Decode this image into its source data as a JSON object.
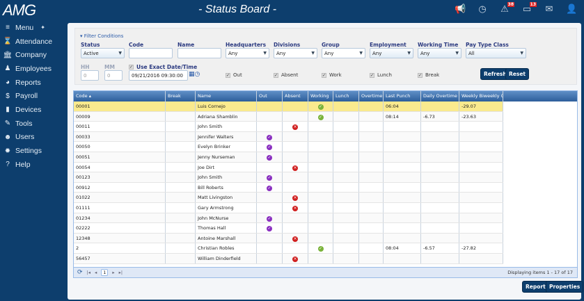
{
  "app": {
    "logo": "AMG",
    "title": "- Status Board -"
  },
  "topbar": {
    "icons": [
      {
        "name": "megaphone-icon",
        "glyph": "📢"
      },
      {
        "name": "clock-icon",
        "glyph": "◷"
      },
      {
        "name": "alert-icon",
        "glyph": "⚠",
        "badge": "38"
      },
      {
        "name": "calendar-icon",
        "glyph": "▭",
        "badge": "13"
      },
      {
        "name": "mail-icon",
        "glyph": "✉"
      },
      {
        "name": "user-icon",
        "glyph": "👤"
      }
    ]
  },
  "sidebar": {
    "items": [
      {
        "label": "Menu",
        "icon": "≡"
      },
      {
        "label": "Attendance",
        "icon": "⌛"
      },
      {
        "label": "Company",
        "icon": "🏛"
      },
      {
        "label": "Employees",
        "icon": "♟"
      },
      {
        "label": "Reports",
        "icon": "◕"
      },
      {
        "label": "Payroll",
        "icon": "$"
      },
      {
        "label": "Devices",
        "icon": "▮"
      },
      {
        "label": "Tools",
        "icon": "✎"
      },
      {
        "label": "Users",
        "icon": "☻"
      },
      {
        "label": "Settings",
        "icon": "✹"
      },
      {
        "label": "Help",
        "icon": "?"
      }
    ]
  },
  "filter": {
    "toggle": "▾ Filter Conditions",
    "status": {
      "label": "Status",
      "value": "Active"
    },
    "code": {
      "label": "Code",
      "value": ""
    },
    "name": {
      "label": "Name",
      "value": ""
    },
    "headquarters": {
      "label": "Headquarters",
      "value": "Any"
    },
    "divisions": {
      "label": "Divisions",
      "value": "Any"
    },
    "group": {
      "label": "Group",
      "value": "Any"
    },
    "employment": {
      "label": "Employment",
      "value": "Any"
    },
    "working_time": {
      "label": "Working Time",
      "value": "Any"
    },
    "pay_type_class": {
      "label": "Pay Type Class",
      "value": "All"
    },
    "hh": {
      "label": "HH",
      "value": "0"
    },
    "mm": {
      "label": "MM",
      "value": "0"
    },
    "exact": {
      "label": "Use Exact Date/Time",
      "checked": true,
      "value": "09/21/2016 09:30:00"
    },
    "checks": [
      "Out",
      "Absent",
      "Work",
      "Lunch",
      "Break"
    ],
    "refresh": "Refresh",
    "reset": "Reset"
  },
  "grid": {
    "columns": [
      "Code ▴",
      "Break",
      "Name",
      "Out",
      "Absent",
      "Working",
      "Lunch",
      "Overtime",
      "Last Punch",
      "Daily Overtime",
      "Weekly Biweekly Ov"
    ],
    "rows": [
      [
        "00001",
        "",
        "Luis Cornejo",
        "work",
        "06:04",
        "",
        "-29.07"
      ],
      [
        "00009",
        "",
        "Adriana Shamblin",
        "work",
        "08:14",
        "-6.73",
        "-23.63"
      ],
      [
        "00011",
        "",
        "John Smith",
        "absent",
        "",
        "",
        ""
      ],
      [
        "00033",
        "",
        "Jennifer Walters",
        "out",
        "",
        "",
        ""
      ],
      [
        "00050",
        "",
        "Evelyn Brinker",
        "out",
        "",
        "",
        ""
      ],
      [
        "00051",
        "",
        "Jenny Nurseman",
        "out",
        "",
        "",
        ""
      ],
      [
        "00054",
        "",
        "Joe Dirt",
        "absent",
        "",
        "",
        ""
      ],
      [
        "00123",
        "",
        "John Smith",
        "out",
        "",
        "",
        ""
      ],
      [
        "00912",
        "",
        "Bill Roberts",
        "out",
        "",
        "",
        ""
      ],
      [
        "01022",
        "",
        "Matt Livingston",
        "absent",
        "",
        "",
        ""
      ],
      [
        "01111",
        "",
        "Gary Armstrong",
        "absent",
        "",
        "",
        ""
      ],
      [
        "01234",
        "",
        "John McNurse",
        "out",
        "",
        "",
        ""
      ],
      [
        "02222",
        "",
        "Thomas Hall",
        "out",
        "",
        "",
        ""
      ],
      [
        "12348",
        "",
        "Antoine Marshall",
        "absent",
        "",
        "",
        ""
      ],
      [
        "2",
        "",
        "Christian Robles",
        "work",
        "08:04",
        "-6.57",
        "-27.82"
      ],
      [
        "56457",
        "",
        "William Dinderfield",
        "absent",
        "",
        "",
        ""
      ]
    ],
    "selected_row": 0
  },
  "pager": {
    "page": "1",
    "display": "Displaying items 1 - 17 of 17"
  },
  "actions": {
    "report": "Report",
    "properties": "Properties"
  }
}
